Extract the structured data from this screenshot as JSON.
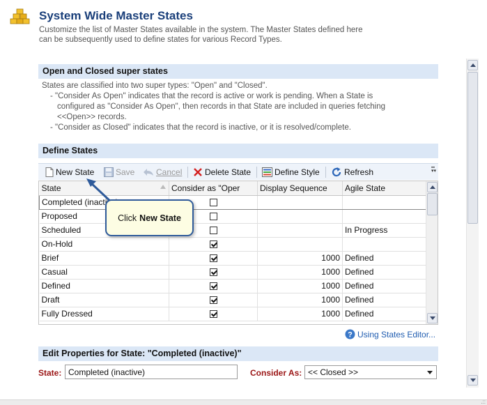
{
  "header": {
    "title": "System Wide Master States",
    "subtitle": "Customize the list of Master States available in the system. The Master States defined here can be subsequently used to define states for various Record Types."
  },
  "super_states": {
    "heading": "Open and Closed super states",
    "intro": "States are classified into two super types: \"Open\" and \"Closed\".",
    "open_line1": "- \"Consider As Open\" indicates that the record is active or work is pending. When a State is",
    "open_line2": "configured as \"Consider As Open\", then records in that State are included in queries fetching",
    "open_line3": "<<Open>> records.",
    "closed_line": "- \"Consider as Closed\" indicates that the record is inactive, or it is resolved/complete."
  },
  "define_states": {
    "heading": "Define States",
    "toolbar": {
      "new_state": "New State",
      "save": "Save",
      "cancel": "Cancel",
      "delete_state": "Delete State",
      "define_style": "Define Style",
      "refresh": "Refresh"
    },
    "columns": [
      "State",
      "Consider as \"Oper",
      "Display Sequence",
      "Agile State"
    ],
    "rows": [
      {
        "state": "Completed (inactive)",
        "open": false,
        "seq": "",
        "agile": ""
      },
      {
        "state": "Proposed",
        "open": false,
        "seq": "",
        "agile": ""
      },
      {
        "state": "Scheduled",
        "open": false,
        "seq": "",
        "agile": "In Progress"
      },
      {
        "state": "On-Hold",
        "open": true,
        "seq": "",
        "agile": ""
      },
      {
        "state": "Brief",
        "open": true,
        "seq": "1000",
        "agile": "Defined"
      },
      {
        "state": "Casual",
        "open": true,
        "seq": "1000",
        "agile": "Defined"
      },
      {
        "state": "Defined",
        "open": true,
        "seq": "1000",
        "agile": "Defined"
      },
      {
        "state": "Draft",
        "open": true,
        "seq": "1000",
        "agile": "Defined"
      },
      {
        "state": "Fully Dressed",
        "open": true,
        "seq": "1000",
        "agile": "Defined"
      }
    ],
    "help_link": "Using States Editor..."
  },
  "callout": {
    "prefix": "Click",
    "target": "New State"
  },
  "edit": {
    "heading": "Edit Properties for State: \"Completed (inactive)\"",
    "state_label": "State:",
    "state_value": "Completed (inactive)",
    "consider_label": "Consider As:",
    "consider_value": "<< Closed >>"
  },
  "colors": {
    "title": "#1a3f7a",
    "section_bar": "#dbe7f6",
    "field_label": "#9b1616",
    "callout_border": "#2e5a9a",
    "callout_bg": "#fdfde3",
    "link": "#1f5cb0"
  }
}
